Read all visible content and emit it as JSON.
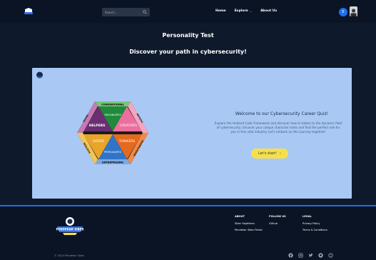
{
  "nav": {
    "search_placeholder": "Search...",
    "links": [
      {
        "label": "Home"
      },
      {
        "label": "Explore"
      },
      {
        "label": "About Us"
      }
    ],
    "lang": "E"
  },
  "page": {
    "title": "Personality Test",
    "subtitle": "Discover your path in cybersecurity!"
  },
  "card": {
    "hex_top_label": "CONVENTIONAL",
    "hex_bottom_label": "ENTERPRISING",
    "hex_left_top": "SOCIAL",
    "hex_left_bottom": "REALISTIC",
    "hex_right_top": "ARTISTIC",
    "hex_right_bottom": "INVESTIGATIVE",
    "seg_organizers": "ORGANIZERS",
    "seg_helpers": "HELPERS",
    "seg_creators": "CREATORS",
    "seg_doers": "DOERS",
    "seg_thinkers": "THINKERS",
    "seg_persuaders": "PERSUADERS",
    "welcome_title": "Welcome to our Cybersecurity Career Quiz!",
    "welcome_body": "Explore the Holland Code framework and discover how it relates to the dynamic field of cybersecurity. Uncover your unique character traits and find the perfect role for you in this vital industry. Let's embark on this journey together!",
    "start_label": "Let's start!"
  },
  "footer": {
    "logo_text": "PENDEKAR SIBER",
    "about_head": "ABOUT",
    "about_items": [
      "Siber Sejahtera",
      "Pendekar Siber Portal"
    ],
    "follow_head": "FOLLOW US",
    "follow_items": [
      "Github"
    ],
    "legal_head": "LEGAL",
    "legal_items": [
      "Privacy Policy",
      "Terms & Conditions"
    ],
    "copyright": "© 2024 Pendekar Siber"
  }
}
